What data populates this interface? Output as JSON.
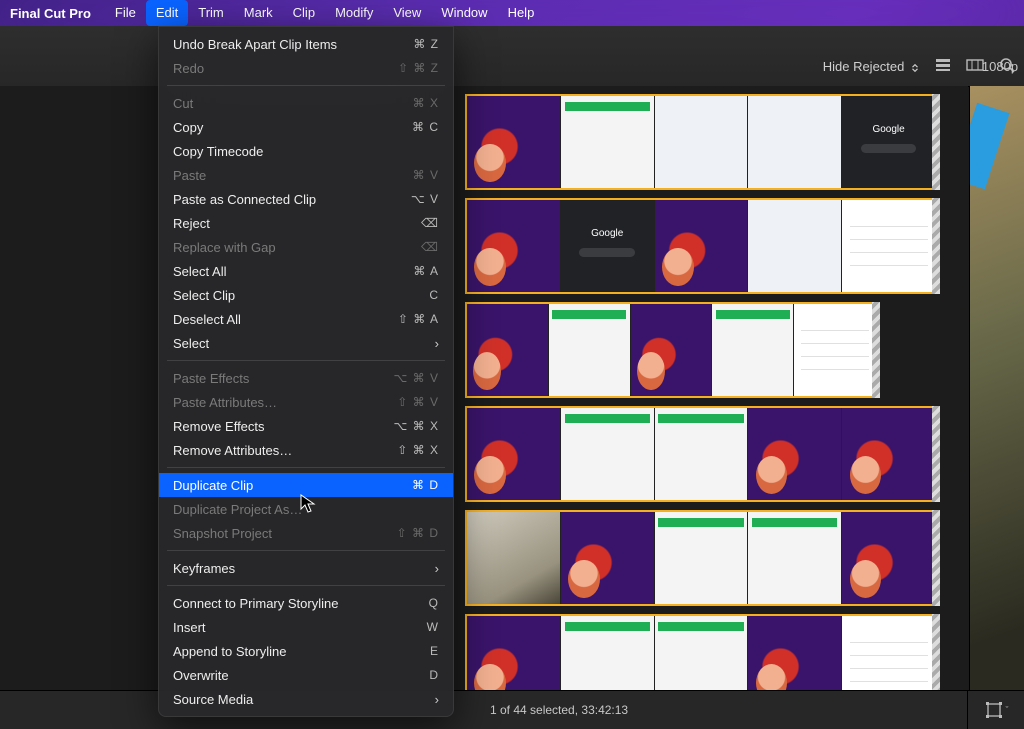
{
  "menubar": {
    "app": "Final Cut Pro",
    "items": [
      "File",
      "Edit",
      "Trim",
      "Mark",
      "Clip",
      "Modify",
      "View",
      "Window",
      "Help"
    ],
    "open_index": 1
  },
  "edit_menu": {
    "rows": [
      {
        "t": "item",
        "label": "Undo Break Apart Clip Items",
        "shortcut": "⌘ Z",
        "enabled": true
      },
      {
        "t": "item",
        "label": "Redo",
        "shortcut": "⇧ ⌘ Z",
        "enabled": false
      },
      {
        "t": "sep"
      },
      {
        "t": "item",
        "label": "Cut",
        "shortcut": "⌘ X",
        "enabled": false
      },
      {
        "t": "item",
        "label": "Copy",
        "shortcut": "⌘ C",
        "enabled": true
      },
      {
        "t": "item",
        "label": "Copy Timecode",
        "shortcut": "",
        "enabled": true
      },
      {
        "t": "item",
        "label": "Paste",
        "shortcut": "⌘ V",
        "enabled": false
      },
      {
        "t": "item",
        "label": "Paste as Connected Clip",
        "shortcut": "⌥ V",
        "enabled": true
      },
      {
        "t": "item",
        "label": "Reject",
        "shortcut": "⌫",
        "enabled": true
      },
      {
        "t": "item",
        "label": "Replace with Gap",
        "shortcut": "⌫",
        "enabled": false
      },
      {
        "t": "item",
        "label": "Select All",
        "shortcut": "⌘ A",
        "enabled": true
      },
      {
        "t": "item",
        "label": "Select Clip",
        "shortcut": "C",
        "enabled": true
      },
      {
        "t": "item",
        "label": "Deselect All",
        "shortcut": "⇧ ⌘ A",
        "enabled": true
      },
      {
        "t": "sub",
        "label": "Select",
        "enabled": true
      },
      {
        "t": "sep"
      },
      {
        "t": "item",
        "label": "Paste Effects",
        "shortcut": "⌥ ⌘ V",
        "enabled": false
      },
      {
        "t": "item",
        "label": "Paste Attributes…",
        "shortcut": "⇧ ⌘ V",
        "enabled": false
      },
      {
        "t": "item",
        "label": "Remove Effects",
        "shortcut": "⌥ ⌘ X",
        "enabled": true
      },
      {
        "t": "item",
        "label": "Remove Attributes…",
        "shortcut": "⇧ ⌘ X",
        "enabled": true
      },
      {
        "t": "sep"
      },
      {
        "t": "item",
        "label": "Duplicate Clip",
        "shortcut": "⌘ D",
        "enabled": true,
        "highlight": true
      },
      {
        "t": "item",
        "label": "Duplicate Project As…",
        "shortcut": "",
        "enabled": false
      },
      {
        "t": "item",
        "label": "Snapshot Project",
        "shortcut": "⇧ ⌘ D",
        "enabled": false
      },
      {
        "t": "sep"
      },
      {
        "t": "sub",
        "label": "Keyframes",
        "enabled": true
      },
      {
        "t": "sep"
      },
      {
        "t": "item",
        "label": "Connect to Primary Storyline",
        "shortcut": "Q",
        "enabled": true
      },
      {
        "t": "item",
        "label": "Insert",
        "shortcut": "W",
        "enabled": true
      },
      {
        "t": "item",
        "label": "Append to Storyline",
        "shortcut": "E",
        "enabled": true
      },
      {
        "t": "item",
        "label": "Overwrite",
        "shortcut": "D",
        "enabled": true
      },
      {
        "t": "sub",
        "label": "Source Media",
        "enabled": true
      }
    ]
  },
  "toolbar": {
    "filter_label": "Hide Rejected",
    "resolution": "1080p"
  },
  "status": {
    "text": "1 of 44 selected, 33:42:13"
  },
  "browser_rows": [
    {
      "frames": [
        "purple",
        "white",
        "white2",
        "white2",
        "dark"
      ],
      "short": false
    },
    {
      "frames": [
        "purple",
        "dark",
        "purple",
        "white2",
        "form"
      ],
      "short": false
    },
    {
      "frames": [
        "purple",
        "white",
        "purple",
        "white",
        "form"
      ],
      "short": true
    },
    {
      "frames": [
        "purple",
        "white",
        "white",
        "purple",
        "purple"
      ],
      "short": false
    },
    {
      "frames": [
        "photo",
        "purple",
        "white",
        "white",
        "purple"
      ],
      "short": false
    },
    {
      "frames": [
        "purple",
        "white",
        "white",
        "purple",
        "form"
      ],
      "short": false
    }
  ]
}
